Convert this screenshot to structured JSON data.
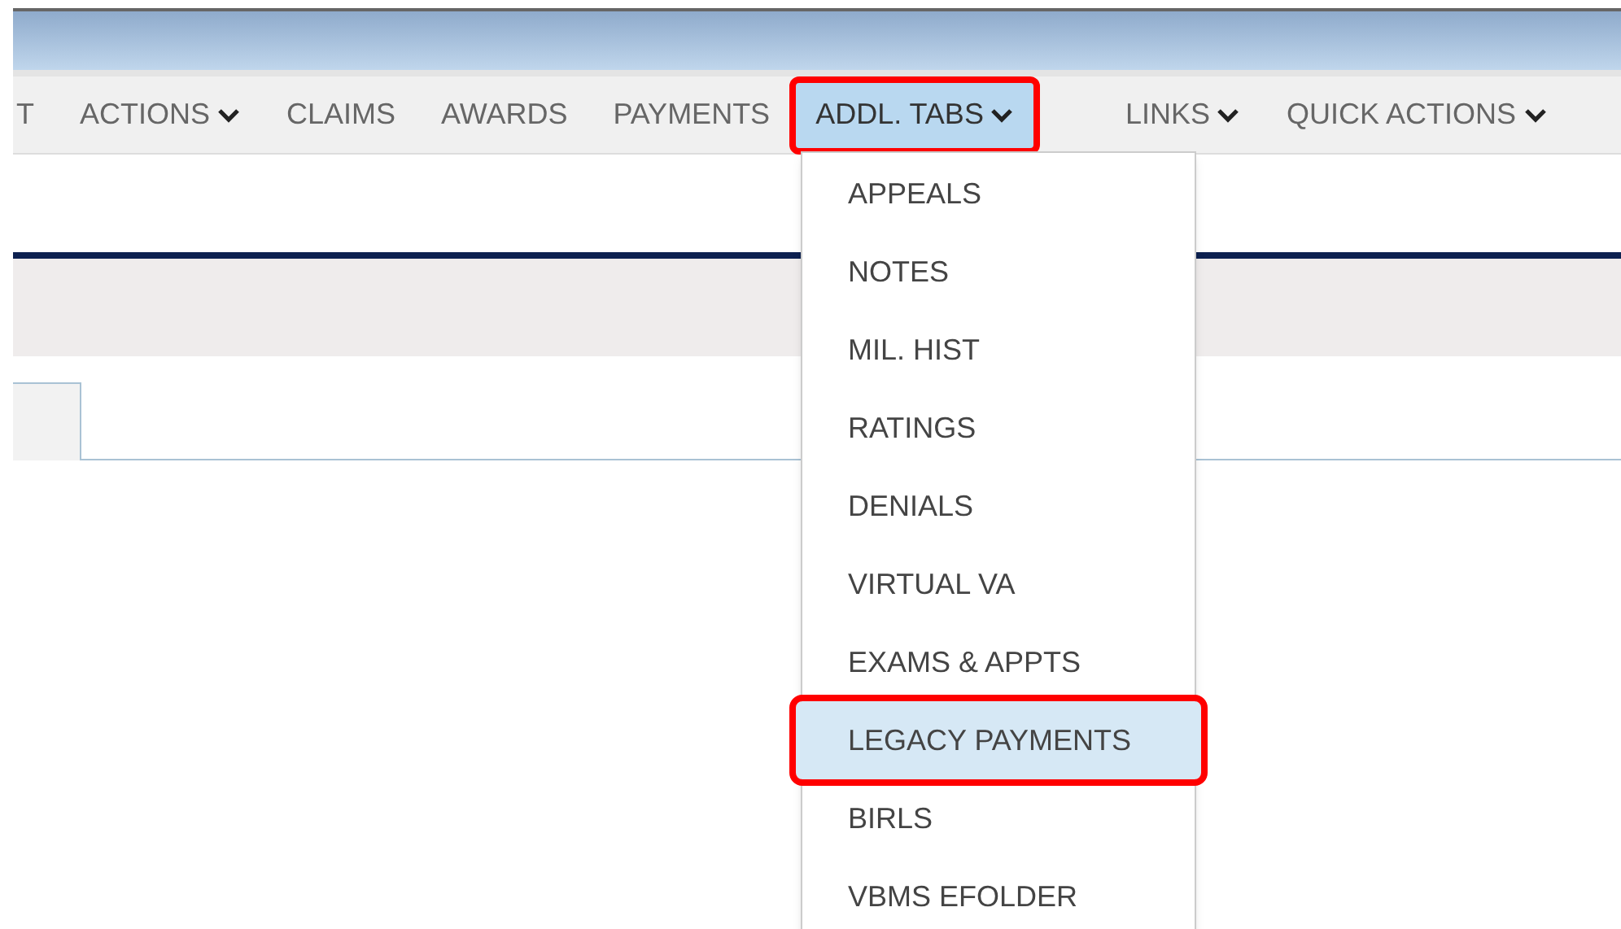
{
  "nav": {
    "left_items": [
      {
        "label": "T",
        "has_menu": false,
        "selected": false,
        "annotated": false
      },
      {
        "label": "ACTIONS",
        "has_menu": true,
        "selected": false,
        "annotated": false
      },
      {
        "label": "CLAIMS",
        "has_menu": false,
        "selected": false,
        "annotated": false
      },
      {
        "label": "AWARDS",
        "has_menu": false,
        "selected": false,
        "annotated": false
      },
      {
        "label": "PAYMENTS",
        "has_menu": false,
        "selected": false,
        "annotated": false
      },
      {
        "label": "ADDL. TABS",
        "has_menu": true,
        "selected": true,
        "annotated": true
      }
    ],
    "right_items": [
      {
        "label": "LINKS",
        "has_menu": true,
        "selected": false,
        "annotated": false
      },
      {
        "label": "QUICK ACTIONS",
        "has_menu": true,
        "selected": false,
        "annotated": false
      }
    ]
  },
  "dropdown": {
    "items": [
      {
        "label": "APPEALS",
        "selected": false,
        "annotated": false
      },
      {
        "label": "NOTES",
        "selected": false,
        "annotated": false
      },
      {
        "label": "MIL. HIST",
        "selected": false,
        "annotated": false
      },
      {
        "label": "RATINGS",
        "selected": false,
        "annotated": false
      },
      {
        "label": "DENIALS",
        "selected": false,
        "annotated": false
      },
      {
        "label": "VIRTUAL VA",
        "selected": false,
        "annotated": false
      },
      {
        "label": "EXAMS & APPTS",
        "selected": false,
        "annotated": false
      },
      {
        "label": "LEGACY PAYMENTS",
        "selected": true,
        "annotated": true
      },
      {
        "label": "BIRLS",
        "selected": false,
        "annotated": false
      },
      {
        "label": "VBMS EFOLDER",
        "selected": false,
        "annotated": false
      }
    ]
  }
}
